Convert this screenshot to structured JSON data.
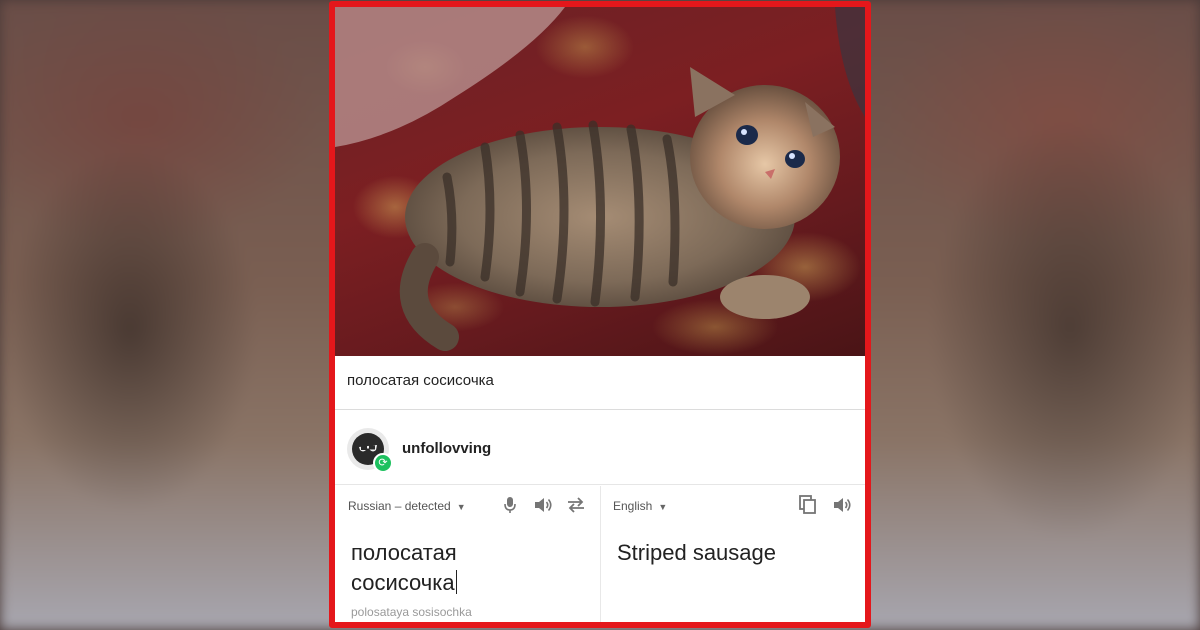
{
  "post": {
    "caption": "полосатая сосисочка",
    "username": "unfollovving"
  },
  "translate": {
    "source_lang": "Russian – detected",
    "target_lang": "English",
    "source_line1": "полосатая",
    "source_line2": "сосисочка",
    "transliteration": "polosataya sosisochka",
    "translation": "Striped sausage"
  },
  "icons": {
    "mic": "microphone-icon",
    "speaker": "speaker-icon",
    "swap": "swap-languages-icon",
    "copy": "copy-icon",
    "badge": "repost-icon"
  },
  "colors": {
    "frame_border": "#e4171b",
    "badge_green": "#1ec15f",
    "icon_gray": "#757575"
  }
}
